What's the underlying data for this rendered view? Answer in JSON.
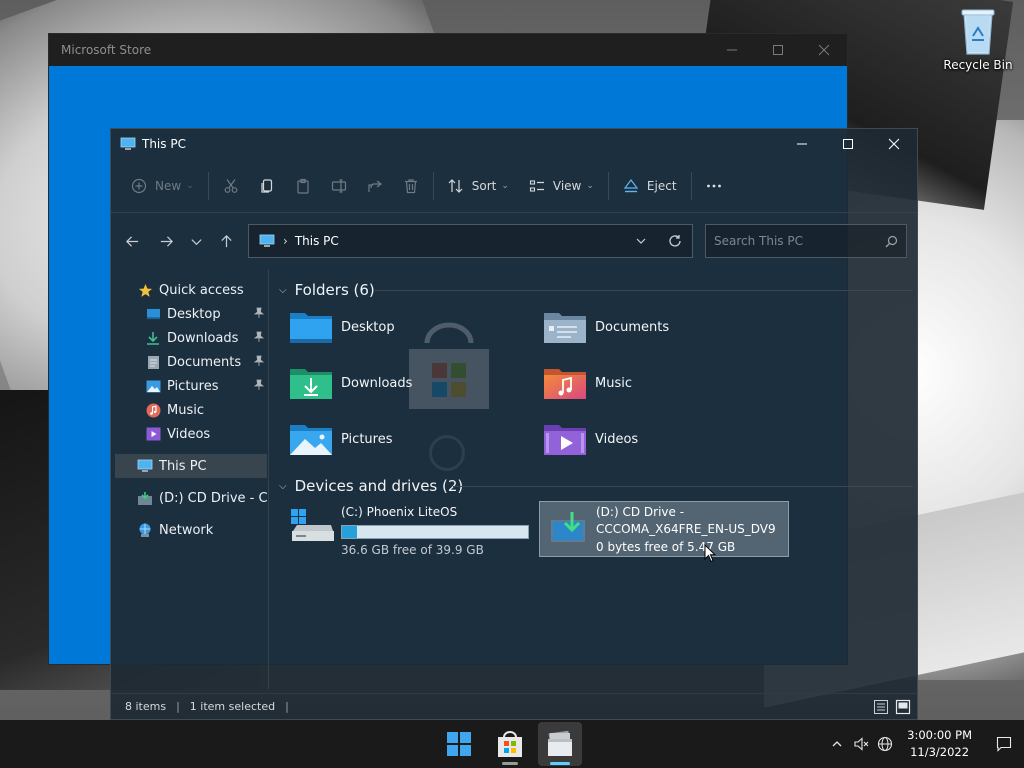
{
  "desktop": {
    "recycle_bin_label": "Recycle Bin"
  },
  "store_window": {
    "title": "Microsoft Store",
    "accent_color": "#0078d7"
  },
  "explorer": {
    "title": "This PC",
    "toolbar": {
      "new_label": "New",
      "sort_label": "Sort",
      "view_label": "View",
      "eject_label": "Eject",
      "icons": [
        "cut-icon",
        "copy-icon",
        "paste-icon",
        "rename-icon",
        "share-icon",
        "delete-icon",
        "more-icon"
      ]
    },
    "address": {
      "crumb": "This PC",
      "search_placeholder": "Search This PC"
    },
    "nav": {
      "quick_access": "Quick access",
      "items": [
        {
          "label": "Desktop",
          "pinned": true
        },
        {
          "label": "Downloads",
          "pinned": true
        },
        {
          "label": "Documents",
          "pinned": true
        },
        {
          "label": "Pictures",
          "pinned": true
        },
        {
          "label": "Music",
          "pinned": false
        },
        {
          "label": "Videos",
          "pinned": false
        }
      ],
      "this_pc": "This PC",
      "cd_drive": "(D:) CD Drive - CCC",
      "network": "Network"
    },
    "folders_header": "Folders (6)",
    "folders": [
      {
        "label": "Desktop"
      },
      {
        "label": "Documents"
      },
      {
        "label": "Downloads"
      },
      {
        "label": "Music"
      },
      {
        "label": "Pictures"
      },
      {
        "label": "Videos"
      }
    ],
    "drives_header": "Devices and drives (2)",
    "drives": [
      {
        "name": "(C:) Phoenix LiteOS",
        "free_text": "36.6 GB free of 39.9 GB",
        "used_fraction": 0.083
      },
      {
        "name_line1": "(D:) CD Drive -",
        "name_line2": "CCCOMA_X64FRE_EN-US_DV9",
        "free_text": "0 bytes free of 5.47 GB"
      }
    ],
    "status": {
      "items": "8 items",
      "selected": "1 item selected"
    }
  },
  "taskbar": {
    "time": "3:00:00 PM",
    "date": "11/3/2022"
  }
}
